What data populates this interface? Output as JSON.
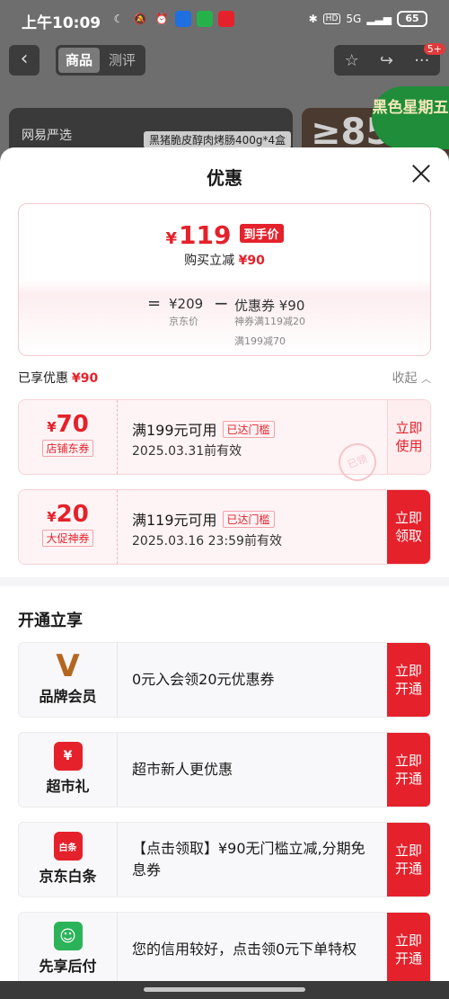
{
  "status": {
    "time": "上午10:09",
    "network": "5G",
    "battery": "65"
  },
  "nav": {
    "tabs": [
      "商品",
      "测评"
    ],
    "badge": "5+"
  },
  "background": {
    "brand": "网易严选",
    "product": "黑猪脆皮醇肉烤肠400g*4盒",
    "promo_number": "≥85",
    "black_friday": "黑色星期五"
  },
  "sheet": {
    "title": "优惠",
    "final_price": "119",
    "currency": "¥",
    "final_tag": "到手价",
    "reduce_prefix": "购买立减",
    "reduce_amount": "¥90",
    "calc": {
      "equals": "=",
      "original": "¥209",
      "original_label": "京东价",
      "minus": "−",
      "coupon": "优惠券 ¥90",
      "coupon_detail_1": "神券满119减20",
      "coupon_detail_2": "满199减70"
    },
    "enjoyed_label": "已享优惠",
    "enjoyed_amount": "¥90",
    "collapse": "收起"
  },
  "coupons": [
    {
      "amount": "70",
      "type": "店铺东券",
      "condition": "满199元可用",
      "status": "已达门槛",
      "valid": "2025.03.31前有效",
      "action": "立即使用",
      "stamp": "已领"
    },
    {
      "amount": "20",
      "type": "大促神券",
      "condition": "满119元可用",
      "status": "已达门槛",
      "valid": "2025.03.16 23:59前有效",
      "action": "立即领取"
    }
  ],
  "open_section": {
    "title": "开通立享",
    "items": [
      {
        "name": "品牌会员",
        "desc": "0元入会领20元优惠券",
        "action": "立即开通",
        "icon": "brand-member-icon",
        "icon_glyph": "V",
        "icon_color": "#b4661f"
      },
      {
        "name": "超市礼",
        "desc": "超市新人更优惠",
        "action": "立即开通",
        "icon": "supermarket-gift-icon",
        "icon_glyph": "¥",
        "icon_color": "#e5212b"
      },
      {
        "name": "京东白条",
        "desc": "【点击领取】¥90无门槛立减,分期免息券",
        "action": "立即开通",
        "icon": "baitiao-icon",
        "icon_glyph": "白条",
        "icon_color": "#e5212b"
      },
      {
        "name": "先享后付",
        "desc": "您的信用较好，点击领0元下单特权",
        "action": "立即开通",
        "icon": "pay-later-icon",
        "icon_glyph": "☺",
        "icon_color": "#2bb35a"
      }
    ]
  },
  "colors": {
    "accent": "#e5212b",
    "coupon_bg": "#fff4f5"
  }
}
